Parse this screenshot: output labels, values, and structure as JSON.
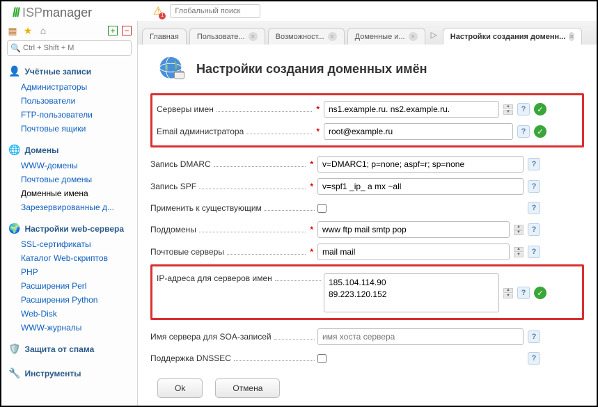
{
  "logo_text": "manager",
  "logo_prefix": "ISP",
  "global_search_placeholder": "Глобальный поиск",
  "quick_search_placeholder": "Ctrl + Shift + M",
  "nav": {
    "accounts": {
      "title": "Учётные записи",
      "items": [
        "Администраторы",
        "Пользователи",
        "FTP-пользователи",
        "Почтовые ящики"
      ]
    },
    "domains": {
      "title": "Домены",
      "items": [
        "WWW-домены",
        "Почтовые домены",
        "Доменные имена",
        "Зарезервированные д..."
      ],
      "active_index": 2
    },
    "web": {
      "title": "Настройки web-сервера",
      "items": [
        "SSL-сертификаты",
        "Каталог Web-скриптов",
        "PHP",
        "Расширения Perl",
        "Расширения Python",
        "Web-Disk",
        "WWW-журналы"
      ]
    },
    "spam": {
      "title": "Защита от спама"
    },
    "tools": {
      "title": "Инструменты"
    }
  },
  "tabs": [
    {
      "label": "Главная"
    },
    {
      "label": "Пользовате..."
    },
    {
      "label": "Возможност..."
    },
    {
      "label": "Доменные и..."
    },
    {
      "label": "Настройки создания доменн...",
      "active": true
    }
  ],
  "page_title": "Настройки создания доменных имён",
  "form": {
    "ns_label": "Серверы имен",
    "ns_value": "ns1.example.ru. ns2.example.ru.",
    "admin_email_label": "Email администратора",
    "admin_email_value": "root@example.ru",
    "dmarc_label": "Запись DMARC",
    "dmarc_value": "v=DMARC1; p=none; aspf=r; sp=none",
    "spf_label": "Запись SPF",
    "spf_value": "v=spf1 _ip_ a mx ~all",
    "apply_existing_label": "Применить к существующим",
    "subdomains_label": "Поддомены",
    "subdomains_value": "www ftp mail smtp pop",
    "mail_label": "Почтовые серверы",
    "mail_value": "mail mail",
    "ip_ns_label": "IP-адреса для серверов имен",
    "ip_ns_value": "185.104.114.90\n89.223.120.152",
    "soa_label": "Имя сервера для SOA-записей",
    "soa_placeholder": "имя хоста сервера",
    "dnssec_label": "Поддержка DNSSEC"
  },
  "buttons": {
    "ok": "Ok",
    "cancel": "Отмена"
  }
}
